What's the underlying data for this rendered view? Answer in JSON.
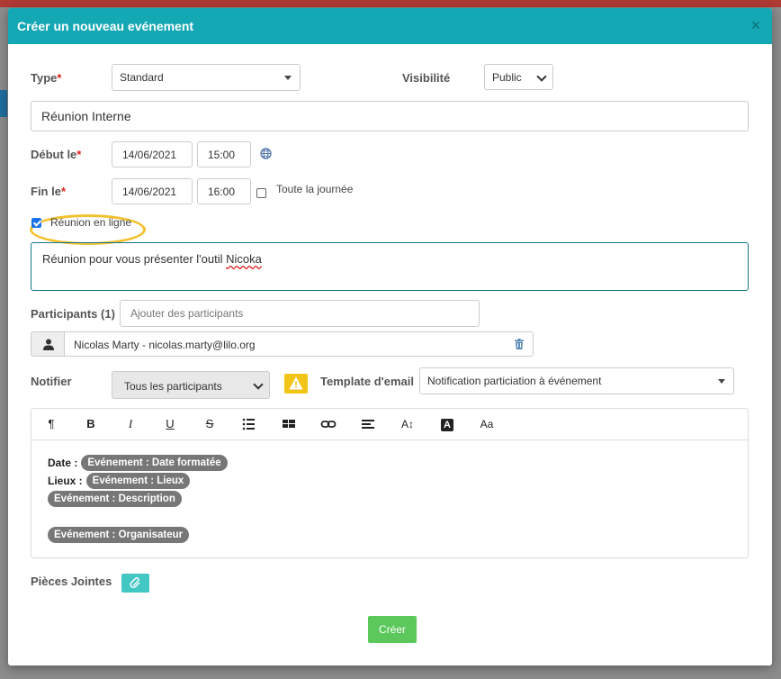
{
  "modal": {
    "title": "Créer un nouveau evénement",
    "close": "×"
  },
  "form": {
    "type_label": "Type",
    "type_value": "Standard",
    "visibility_label": "Visibilité",
    "visibility_value": "Public",
    "title_value": "Réunion Interne",
    "start_label": "Début le",
    "start_date": "14/06/2021",
    "start_time": "15:00",
    "end_label": "Fin le",
    "end_date": "14/06/2021",
    "end_time": "16:00",
    "all_day_label": "Toute la journée",
    "all_day_checked": false,
    "online_label": "Réunion en ligne",
    "online_checked": true,
    "description_prefix": "Réunion pour vous présenter l'outil ",
    "description_misspelled": "Nicoka",
    "required_mark": "*"
  },
  "participants": {
    "label": "Participants (1)",
    "placeholder": "Ajouter des participants",
    "list": [
      {
        "name": "Nicolas Marty - nicolas.marty@lilo.org"
      }
    ]
  },
  "notify": {
    "label": "Notifier",
    "value": "Tous les participants",
    "template_label": "Template d'email",
    "template_value": "Notification particiation à événement"
  },
  "editor": {
    "toolbar": [
      "¶",
      "B",
      "I",
      "U",
      "S",
      "bulleted-list",
      "table",
      "link",
      "align",
      "A↕",
      "A",
      "Aa"
    ],
    "content": {
      "date_label": "Date :",
      "date_tag": "Evénement : Date formatée",
      "place_label": "Lieux :",
      "place_tag": "Evénement : Lieux",
      "description_tag": "Evénement : Description",
      "organizer_tag": "Evénement : Organisateur"
    }
  },
  "attachments": {
    "label": "Pièces Jointes",
    "icon": "paperclip-icon"
  },
  "actions": {
    "create_label": "Créer"
  },
  "colors": {
    "header": "#14a7b4",
    "create_button": "#5cc85c",
    "attach_button": "#42c7c2",
    "highlight": "#f2c12e",
    "warning": "#f2c418"
  }
}
